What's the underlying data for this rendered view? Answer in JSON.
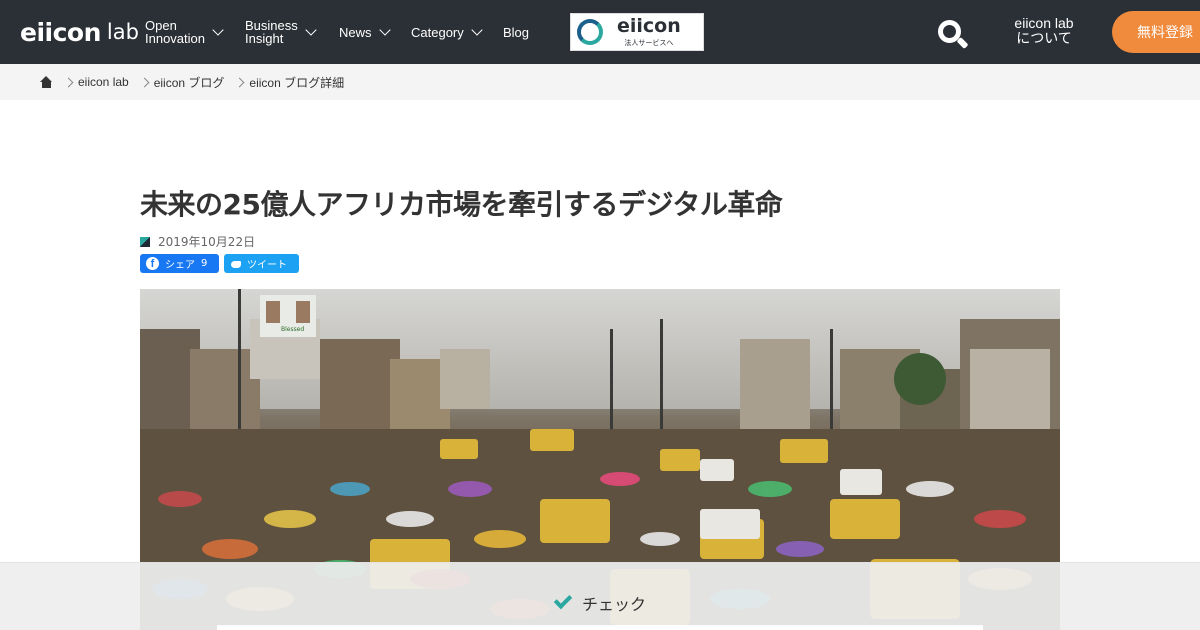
{
  "header": {
    "logo_main": "eiicon",
    "logo_lab": "lab",
    "nav": [
      {
        "line1": "Open",
        "line2": "Innovation"
      },
      {
        "line1": "Business",
        "line2": "Insight"
      },
      {
        "label": "News"
      },
      {
        "label": "Category"
      },
      {
        "label": "Blog"
      }
    ],
    "corp_banner": {
      "name": "eiicon",
      "sub": "法人サービスへ"
    },
    "about": {
      "line1": "eiicon lab",
      "line2": "について"
    },
    "register_label": "無料登録"
  },
  "breadcrumb": [
    "eiicon lab",
    "eiicon ブログ",
    "eiicon ブログ詳細"
  ],
  "article": {
    "title": "未来の25億人アフリカ市場を牽引するデジタル革命",
    "date": "2019年10月22日",
    "share": {
      "facebook_label": "シェア",
      "facebook_count": "9",
      "twitter_label": "ツイート"
    },
    "hero_sign_text": "Blessed"
  },
  "check_bar": {
    "label": "チェック"
  },
  "colors": {
    "header_bg": "#2b3036",
    "accent_orange": "#f08a3c",
    "teal": "#2aa8a0",
    "facebook": "#1877f2",
    "twitter": "#1da1f2"
  },
  "icons": [
    "home-icon",
    "search-icon",
    "chevron-down-icon",
    "chevron-right-icon",
    "calendar-icon",
    "facebook-icon",
    "twitter-icon",
    "check-icon"
  ]
}
